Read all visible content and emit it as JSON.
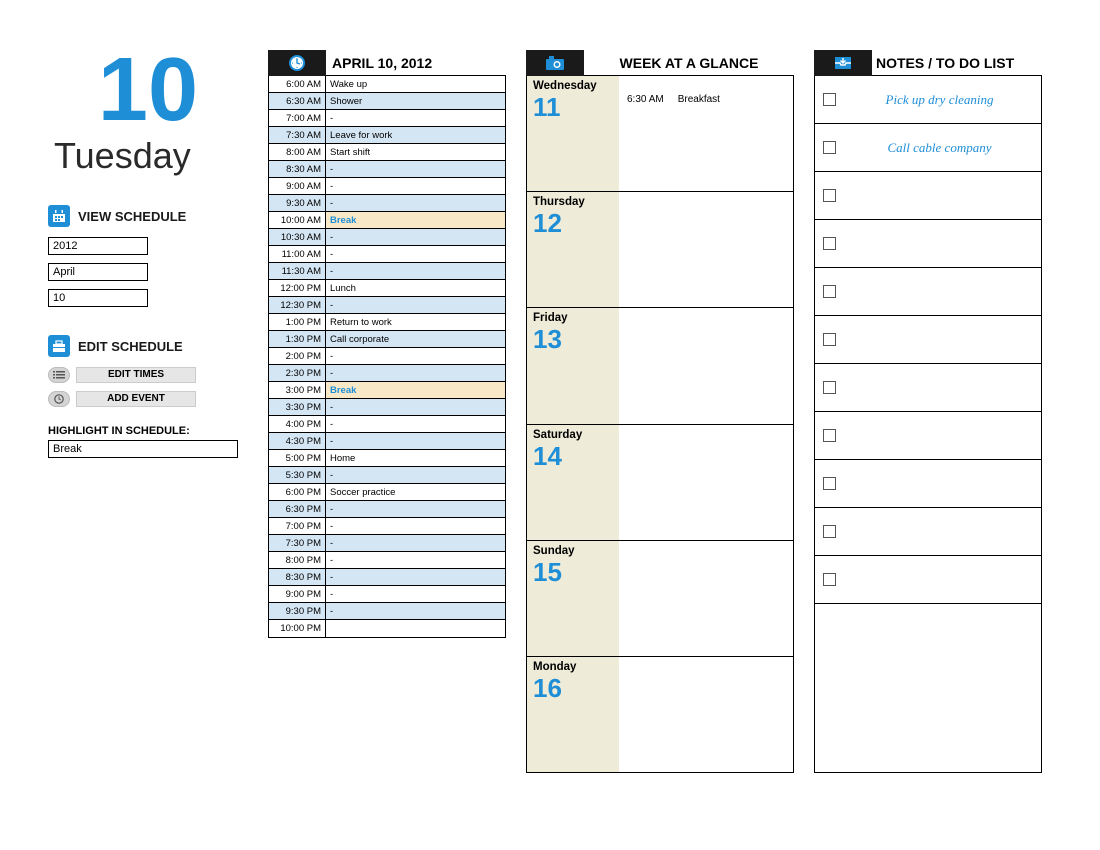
{
  "date": {
    "day_num": "10",
    "weekday": "Tuesday"
  },
  "view_schedule": {
    "title": "VIEW SCHEDULE",
    "year": "2012",
    "month": "April",
    "day": "10"
  },
  "edit_schedule": {
    "title": "EDIT SCHEDULE",
    "edit_times": "EDIT TIMES",
    "add_event": "ADD EVENT"
  },
  "highlight": {
    "label": "HIGHLIGHT IN SCHEDULE:",
    "value": "Break"
  },
  "schedule": {
    "title": "APRIL 10, 2012",
    "rows": [
      {
        "time": "6:00 AM",
        "event": "Wake up"
      },
      {
        "time": "6:30 AM",
        "event": "Shower"
      },
      {
        "time": "7:00 AM",
        "event": "-"
      },
      {
        "time": "7:30 AM",
        "event": "Leave for work"
      },
      {
        "time": "8:00 AM",
        "event": "Start shift"
      },
      {
        "time": "8:30 AM",
        "event": "-"
      },
      {
        "time": "9:00 AM",
        "event": "-"
      },
      {
        "time": "9:30 AM",
        "event": "-"
      },
      {
        "time": "10:00 AM",
        "event": "Break",
        "highlight": true
      },
      {
        "time": "10:30 AM",
        "event": "-"
      },
      {
        "time": "11:00 AM",
        "event": "-"
      },
      {
        "time": "11:30 AM",
        "event": "-"
      },
      {
        "time": "12:00 PM",
        "event": "Lunch"
      },
      {
        "time": "12:30 PM",
        "event": "-"
      },
      {
        "time": "1:00 PM",
        "event": "Return to work"
      },
      {
        "time": "1:30 PM",
        "event": "Call corporate"
      },
      {
        "time": "2:00 PM",
        "event": "-"
      },
      {
        "time": "2:30 PM",
        "event": "-"
      },
      {
        "time": "3:00 PM",
        "event": "Break",
        "highlight": true
      },
      {
        "time": "3:30 PM",
        "event": "-"
      },
      {
        "time": "4:00 PM",
        "event": "-"
      },
      {
        "time": "4:30 PM",
        "event": "-"
      },
      {
        "time": "5:00 PM",
        "event": "Home"
      },
      {
        "time": "5:30 PM",
        "event": "-"
      },
      {
        "time": "6:00 PM",
        "event": "Soccer practice"
      },
      {
        "time": "6:30 PM",
        "event": "-"
      },
      {
        "time": "7:00 PM",
        "event": "-"
      },
      {
        "time": "7:30 PM",
        "event": "-"
      },
      {
        "time": "8:00 PM",
        "event": "-"
      },
      {
        "time": "8:30 PM",
        "event": "-"
      },
      {
        "time": "9:00 PM",
        "event": "-"
      },
      {
        "time": "9:30 PM",
        "event": "-"
      },
      {
        "time": "10:00 PM",
        "event": ""
      }
    ]
  },
  "week": {
    "title": "WEEK AT A GLANCE",
    "days": [
      {
        "name": "Wednesday",
        "num": "11",
        "events": [
          {
            "time": "6:30 AM",
            "label": "Breakfast"
          }
        ]
      },
      {
        "name": "Thursday",
        "num": "12",
        "events": []
      },
      {
        "name": "Friday",
        "num": "13",
        "events": []
      },
      {
        "name": "Saturday",
        "num": "14",
        "events": []
      },
      {
        "name": "Sunday",
        "num": "15",
        "events": []
      },
      {
        "name": "Monday",
        "num": "16",
        "events": []
      }
    ]
  },
  "notes": {
    "title": "NOTES / TO DO LIST",
    "items": [
      "Pick up dry cleaning",
      "Call cable company",
      "",
      "",
      "",
      "",
      "",
      "",
      "",
      "",
      ""
    ]
  }
}
